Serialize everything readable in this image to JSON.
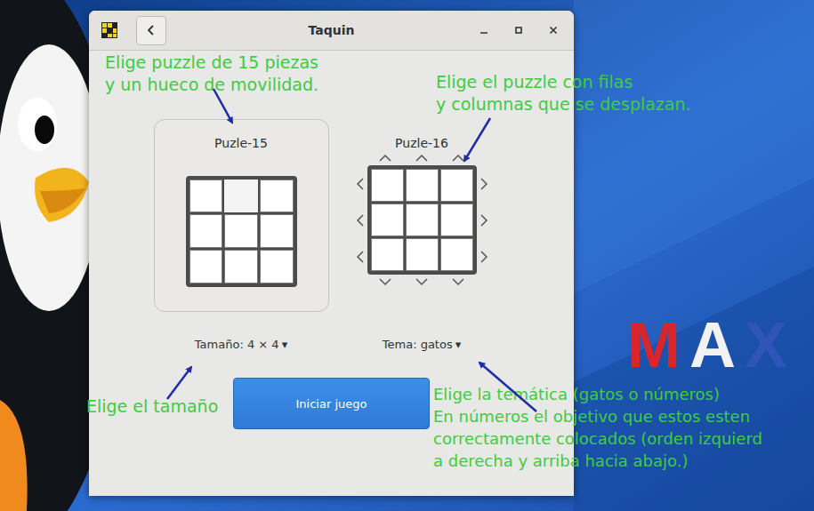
{
  "wallpaper": {
    "logo": [
      {
        "letter": "M",
        "color": "#d8262b"
      },
      {
        "letter": "A",
        "color": "#f2f2f2"
      },
      {
        "letter": "X",
        "color": "#2f55b8"
      }
    ]
  },
  "window": {
    "title": "Taquin"
  },
  "puzzles": [
    {
      "label": "Puzle-15",
      "kind": "sliding",
      "selected": true,
      "cells": [
        {
          "empty": false
        },
        {
          "empty": true
        },
        {
          "empty": false
        },
        {
          "empty": false
        },
        {
          "empty": false
        },
        {
          "empty": false
        },
        {
          "empty": false
        },
        {
          "empty": false
        },
        {
          "empty": false
        }
      ]
    },
    {
      "label": "Puzle-16",
      "kind": "rotating",
      "selected": false,
      "cells": [
        {
          "empty": false
        },
        {
          "empty": false
        },
        {
          "empty": false
        },
        {
          "empty": false
        },
        {
          "empty": false
        },
        {
          "empty": false
        },
        {
          "empty": false
        },
        {
          "empty": false
        },
        {
          "empty": false
        }
      ]
    }
  ],
  "options": [
    {
      "label": "Tamaño: 4 × 4",
      "caret": "▾"
    },
    {
      "label": "Tema: gatos",
      "caret": "▾"
    }
  ],
  "start_button": "Iniciar juego",
  "annotations": [
    {
      "lines": [
        "Elige puzzle de 15 piezas",
        "y un hueco de movilidad."
      ]
    },
    {
      "lines": [
        "Elige el puzzle con filas",
        "y columnas que se desplazan."
      ]
    },
    {
      "lines": [
        "Elige el tamaño"
      ]
    },
    {
      "lines": [
        "Elige la temática (gatos o números)",
        "En números el objetivo que estos esten",
        "correctamente colocados (orden izquierd",
        "a derecha y arriba hacia abajo.)"
      ]
    }
  ]
}
